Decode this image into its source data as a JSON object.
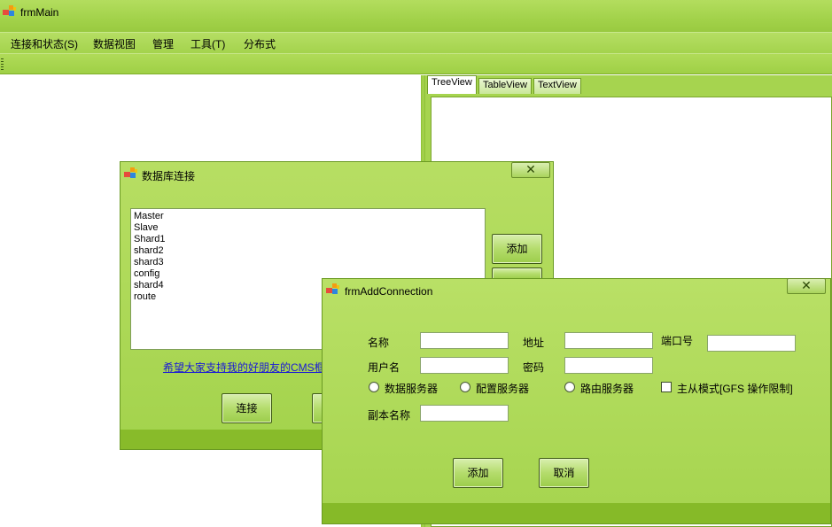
{
  "main_window": {
    "title": "frmMain"
  },
  "menu": {
    "items": [
      "连接和状态(S)",
      "数据视图",
      "管理",
      "工具(T)",
      "分布式"
    ]
  },
  "tabs": [
    "TreeView",
    "TableView",
    "TextView"
  ],
  "db_dialog": {
    "title": "数据库连接",
    "close_label": "✕",
    "connections": [
      "Master",
      "Slave",
      "Shard1",
      "shard2",
      "shard3",
      "config",
      "shard4",
      "route"
    ],
    "add_label": "添加",
    "connect_label": "连接",
    "link_text": "希望大家支持我的好朋友的CMS框"
  },
  "add_dialog": {
    "title": "frmAddConnection",
    "close_label": "✕",
    "name_label": "名称",
    "address_label": "地址",
    "port_label": "端口号",
    "username_label": "用户名",
    "password_label": "密码",
    "radio_data_server": "数据服务器",
    "radio_config_server": "配置服务器",
    "radio_route_server": "路由服务器",
    "master_slave_label": "主从模式[GFS 操作限制]",
    "replica_label": "副本名称",
    "name_value": "",
    "address_value": "",
    "port_value": "",
    "username_value": "",
    "password_value": "",
    "replica_value": "",
    "add_label": "添加",
    "cancel_label": "取消"
  },
  "colors": {
    "accent_green": "#a4d34c",
    "dark_green_bar": "#88bb2a",
    "link_blue": "#1a1ad6"
  }
}
